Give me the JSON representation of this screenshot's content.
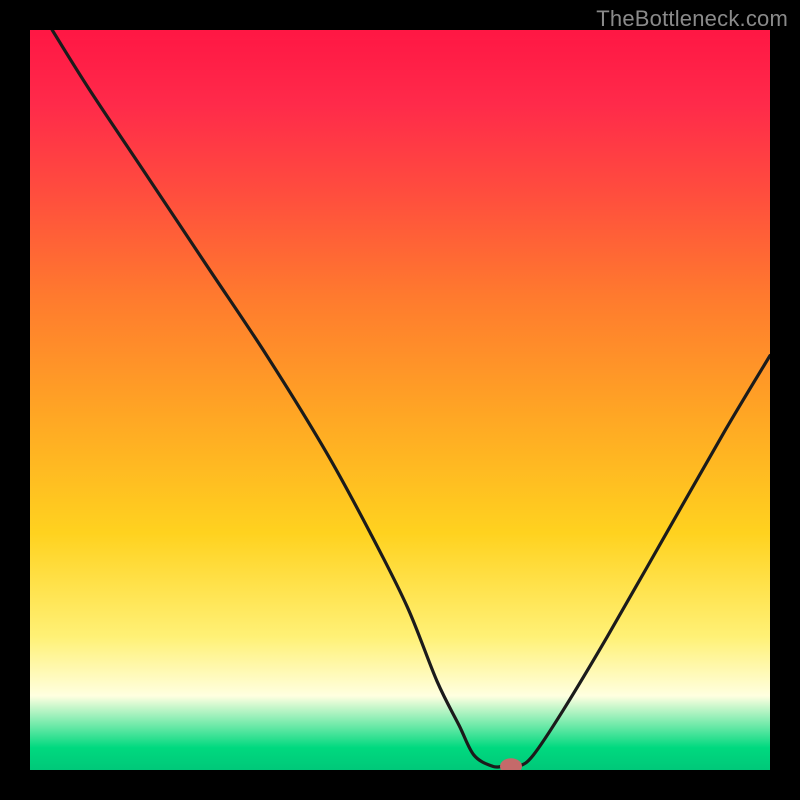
{
  "watermark": "TheBottleneck.com",
  "chart_data": {
    "type": "line",
    "title": "",
    "xlabel": "",
    "ylabel": "",
    "xlim": [
      0,
      100
    ],
    "ylim": [
      0,
      100
    ],
    "series": [
      {
        "name": "bottleneck_curve",
        "x": [
          3,
          8,
          16,
          24,
          32,
          40,
          46,
          51,
          55,
          58,
          60,
          62.5,
          64,
          66,
          68,
          72,
          78,
          86,
          94,
          100
        ],
        "y": [
          100,
          92,
          80,
          68,
          56,
          43,
          32,
          22,
          12,
          6,
          2,
          0.5,
          0.5,
          0.5,
          2,
          8,
          18,
          32,
          46,
          56
        ]
      }
    ],
    "ideal_point": {
      "x": 65,
      "y": 0.5
    },
    "gradient_stops": [
      {
        "pos": 0,
        "color": "#ff1744"
      },
      {
        "pos": 0.1,
        "color": "#ff2a4a"
      },
      {
        "pos": 0.22,
        "color": "#ff4d3e"
      },
      {
        "pos": 0.36,
        "color": "#ff7a2e"
      },
      {
        "pos": 0.52,
        "color": "#ffa624"
      },
      {
        "pos": 0.68,
        "color": "#ffd21f"
      },
      {
        "pos": 0.82,
        "color": "#fff176"
      },
      {
        "pos": 0.9,
        "color": "#ffffe0"
      },
      {
        "pos": 0.97,
        "color": "#00d97f"
      },
      {
        "pos": 1.0,
        "color": "#00c879"
      }
    ]
  }
}
